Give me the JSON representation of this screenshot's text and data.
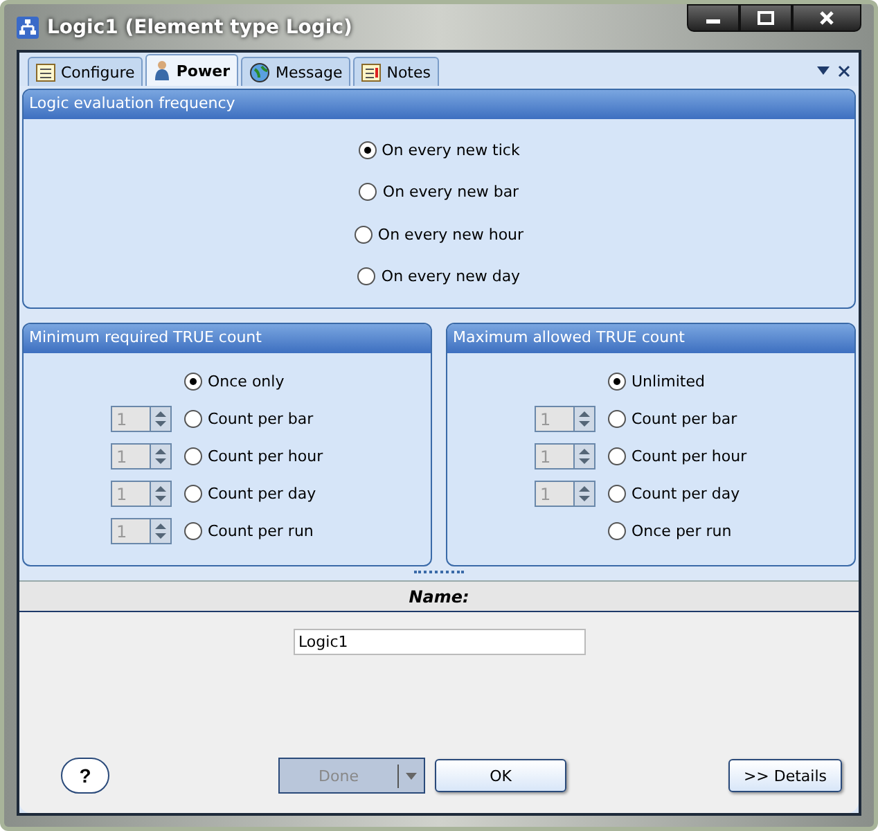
{
  "window": {
    "title": "Logic1 (Element type Logic)"
  },
  "tabs": [
    {
      "label": "Configure",
      "selected": false
    },
    {
      "label": "Power",
      "selected": true
    },
    {
      "label": "Message",
      "selected": false
    },
    {
      "label": "Notes",
      "selected": false
    }
  ],
  "frequency": {
    "title": "Logic evaluation frequency",
    "options": [
      {
        "label": "On every new tick",
        "selected": true
      },
      {
        "label": "On every new bar",
        "selected": false
      },
      {
        "label": "On every new hour",
        "selected": false
      },
      {
        "label": "On every new day",
        "selected": false
      }
    ]
  },
  "groups": [
    {
      "title": "Minimum  required TRUE count",
      "options": [
        {
          "label": "Once only",
          "selected": true
        },
        {
          "label": "Count per bar",
          "selected": false,
          "spinner": {
            "value": "1",
            "disabled": true
          }
        },
        {
          "label": "Count per hour",
          "selected": false,
          "spinner": {
            "value": "1",
            "disabled": true
          }
        },
        {
          "label": "Count per day",
          "selected": false,
          "spinner": {
            "value": "1",
            "disabled": true
          }
        },
        {
          "label": "Count per run",
          "selected": false,
          "spinner": {
            "value": "1",
            "disabled": true
          }
        }
      ]
    },
    {
      "title": "Maximum  allowed TRUE count",
      "options": [
        {
          "label": "Unlimited",
          "selected": true
        },
        {
          "label": "Count per bar",
          "selected": false,
          "spinner": {
            "value": "1",
            "disabled": true
          }
        },
        {
          "label": "Count per hour",
          "selected": false,
          "spinner": {
            "value": "1",
            "disabled": true
          }
        },
        {
          "label": "Count per day",
          "selected": false,
          "spinner": {
            "value": "1",
            "disabled": true
          }
        },
        {
          "label": "Once per run",
          "selected": false
        }
      ]
    }
  ],
  "name_section": {
    "header": "Name:",
    "value": "Logic1"
  },
  "buttons": {
    "help": "?",
    "done": {
      "label": "Done",
      "disabled": true
    },
    "ok": "OK",
    "details": ">> Details"
  }
}
